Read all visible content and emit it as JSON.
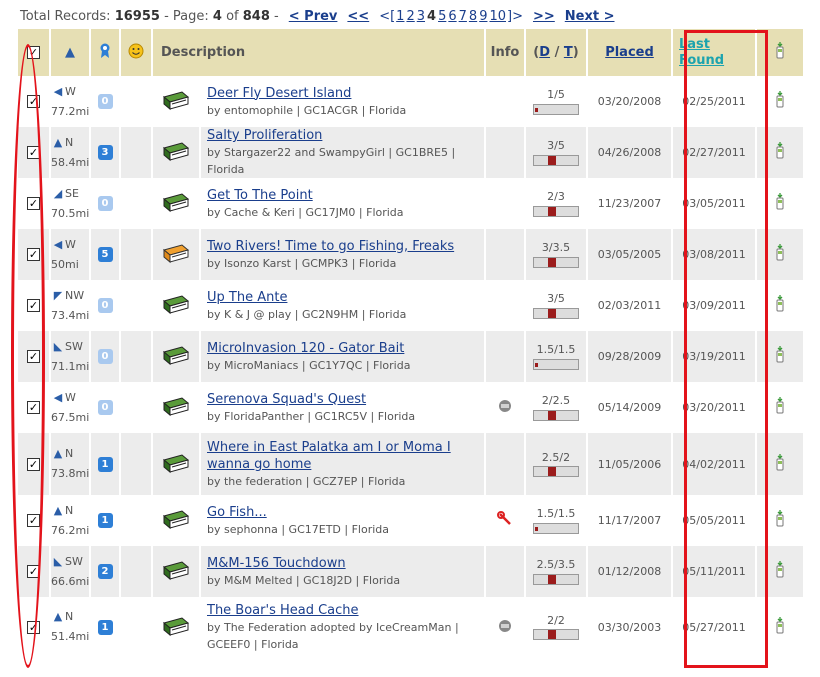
{
  "pager": {
    "total_label": "Total Records:",
    "total": "16955",
    "page_label": "- Page:",
    "page": "4",
    "of": "of",
    "pages": "848",
    "dash": "-",
    "prev": "< Prev",
    "first": "<<",
    "open": "<[",
    "nums": [
      "1",
      "2",
      "3",
      "4",
      "5",
      "6",
      "7",
      "8",
      "9",
      "10"
    ],
    "close": "]>",
    "last": ">>",
    "next": "Next >"
  },
  "header": {
    "description": "Description",
    "info": "Info",
    "dt_open": "(",
    "d": "D",
    "slash": "/",
    "t": "T",
    "dt_close": ")",
    "placed": "Placed",
    "last_found_1": "Last",
    "last_found_2": "Found"
  },
  "rows": [
    {
      "dir": "W",
      "dist": "77.2mi",
      "favs": "0",
      "name": "Deer Fly Desert Island",
      "by": "by entomophile | GC1ACGR | Florida",
      "dt": "1/5",
      "placed": "03/20/2008",
      "last": "02/25/2011",
      "info": "",
      "type": "regular"
    },
    {
      "dir": "N",
      "dist": "58.4mi",
      "favs": "3",
      "name": "Salty Proliferation",
      "by": "by Stargazer22 and SwampyGirl | GC1BRE5 | Florida",
      "dt": "3/5",
      "placed": "04/26/2008",
      "last": "02/27/2011",
      "info": "",
      "type": "regular"
    },
    {
      "dir": "SE",
      "dist": "70.5mi",
      "favs": "0",
      "name": "Get To The Point",
      "by": "by Cache & Keri | GC17JM0 | Florida",
      "dt": "2/3",
      "placed": "11/23/2007",
      "last": "03/05/2011",
      "info": "",
      "type": "regular"
    },
    {
      "dir": "W",
      "dist": "50mi",
      "favs": "5",
      "name": "Two Rivers! Time to go Fishing, Freaks",
      "by": "by Isonzo Karst | GCMPK3 | Florida",
      "dt": "3/3.5",
      "placed": "03/05/2005",
      "last": "03/08/2011",
      "info": "",
      "type": "multi"
    },
    {
      "dir": "NW",
      "dist": "73.4mi",
      "favs": "0",
      "name": "Up The Ante",
      "by": "by K & J @ play | GC2N9HM | Florida",
      "dt": "3/5",
      "placed": "02/03/2011",
      "last": "03/09/2011",
      "info": "",
      "type": "regular"
    },
    {
      "dir": "SW",
      "dist": "71.1mi",
      "favs": "0",
      "name": "MicroInvasion 120 - Gator Bait",
      "by": "by MicroManiacs | GC1Y7QC | Florida",
      "dt": "1.5/1.5",
      "placed": "09/28/2009",
      "last": "03/19/2011",
      "info": "",
      "type": "regular"
    },
    {
      "dir": "W",
      "dist": "67.5mi",
      "favs": "0",
      "name": "Serenova Squad's Quest",
      "by": "by FloridaPanther | GC1RC5V | Florida",
      "dt": "2/2.5",
      "placed": "05/14/2009",
      "last": "03/20/2011",
      "info": "travel",
      "type": "regular"
    },
    {
      "dir": "N",
      "dist": "73.8mi",
      "favs": "1",
      "name": "Where in East Palatka am I or Moma I wanna go home",
      "by": "by the federation | GCZ7EP | Florida",
      "dt": "2.5/2",
      "placed": "11/05/2006",
      "last": "04/02/2011",
      "info": "",
      "type": "regular"
    },
    {
      "dir": "N",
      "dist": "76.2mi",
      "favs": "1",
      "name": "Go Fish...",
      "by": "by sephonna | GC17ETD | Florida",
      "dt": "1.5/1.5",
      "placed": "11/17/2007",
      "last": "05/05/2011",
      "info": "wrench",
      "type": "regular"
    },
    {
      "dir": "SW",
      "dist": "66.6mi",
      "favs": "2",
      "name": "M&M-156 Touchdown",
      "by": "by M&M Melted | GC18J2D | Florida",
      "dt": "2.5/3.5",
      "placed": "01/12/2008",
      "last": "05/11/2011",
      "info": "",
      "type": "regular"
    },
    {
      "dir": "N",
      "dist": "51.4mi",
      "favs": "1",
      "name": "The Boar's Head Cache",
      "by": "by The Federation adopted by IceCreamMan | GCEEF0 | Florida",
      "dt": "2/2",
      "placed": "03/30/2003",
      "last": "05/27/2011",
      "info": "travel",
      "type": "regular"
    }
  ],
  "colors": {
    "header_bg": "#e6dfb4",
    "link": "#1a3e8c",
    "highlight": "#e3131b",
    "badge_zero": "#a9c9ef",
    "badge": "#2e7fd6",
    "difficulty": "#9b1c1c"
  }
}
